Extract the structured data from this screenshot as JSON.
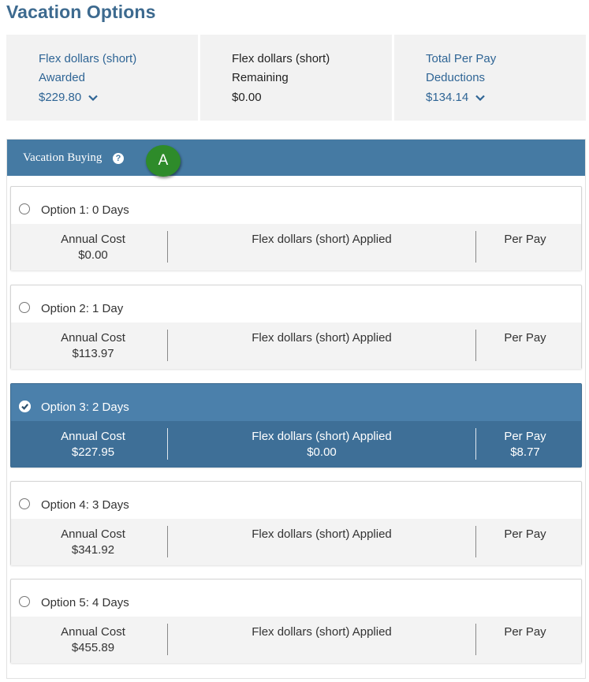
{
  "page_title": "Vacation Options",
  "summary": [
    {
      "label_line1": "Flex dollars (short)",
      "label_line2": "Awarded",
      "amount": "$229.80",
      "has_chevron": true
    },
    {
      "label_line1": "Flex dollars (short)",
      "label_line2": "Remaining",
      "amount": "$0.00",
      "has_chevron": false
    },
    {
      "label_line1": "Total Per Pay",
      "label_line2": "Deductions",
      "amount": "$134.14",
      "has_chevron": true
    }
  ],
  "section": {
    "title": "Vacation Buying",
    "help_icon": "question-circle-icon",
    "badge": "A"
  },
  "columns": {
    "annual_cost": "Annual Cost",
    "flex_applied": "Flex dollars (short) Applied",
    "per_pay": "Per Pay"
  },
  "options": [
    {
      "label": "Option 1: 0 Days",
      "annual_cost": "$0.00",
      "flex_applied": "",
      "per_pay": "",
      "selected": false
    },
    {
      "label": "Option 2: 1 Day",
      "annual_cost": "$113.97",
      "flex_applied": "",
      "per_pay": "",
      "selected": false
    },
    {
      "label": "Option 3: 2 Days",
      "annual_cost": "$227.95",
      "flex_applied": "$0.00",
      "per_pay": "$8.77",
      "selected": true
    },
    {
      "label": "Option 4: 3 Days",
      "annual_cost": "$341.92",
      "flex_applied": "",
      "per_pay": "",
      "selected": false
    },
    {
      "label": "Option 5: 4 Days",
      "annual_cost": "$455.89",
      "flex_applied": "",
      "per_pay": "",
      "selected": false
    }
  ],
  "colors": {
    "header_blue": "#457aa3",
    "selected_blue": "#4478a2",
    "link_blue": "#2f6595",
    "badge_green": "#2e8b2a"
  }
}
